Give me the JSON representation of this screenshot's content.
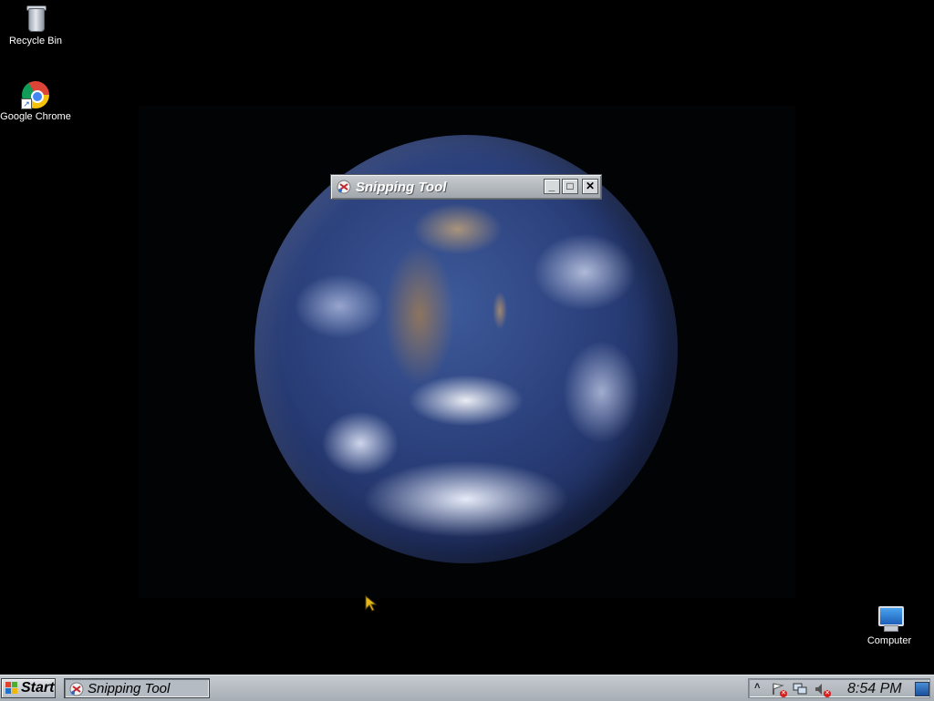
{
  "desktop": {
    "icons": [
      {
        "label": "Recycle Bin",
        "icon": "recycle-bin-icon"
      },
      {
        "label": "Google Chrome",
        "icon": "chrome-icon"
      },
      {
        "label": "Computer",
        "icon": "computer-icon"
      }
    ],
    "wallpaper": "earth"
  },
  "window": {
    "title": "Snipping Tool",
    "icon": "snipping-tool-icon",
    "controls": [
      "minimize",
      "maximize",
      "close"
    ],
    "minimize_glyph": "_",
    "maximize_glyph": "□",
    "close_glyph": "✕"
  },
  "taskbar": {
    "start_label": "Start",
    "items": [
      {
        "label": "Snipping Tool",
        "icon": "snipping-tool-icon"
      }
    ],
    "tray": {
      "chevron": "˄",
      "icons": [
        "action-center-icon",
        "network-icon",
        "volume-icon"
      ],
      "clock": "8:54 PM"
    }
  },
  "colors": {
    "desktop_bg": "#000000",
    "taskbar": "#b0b6bc",
    "title_text": "#ffffff"
  }
}
